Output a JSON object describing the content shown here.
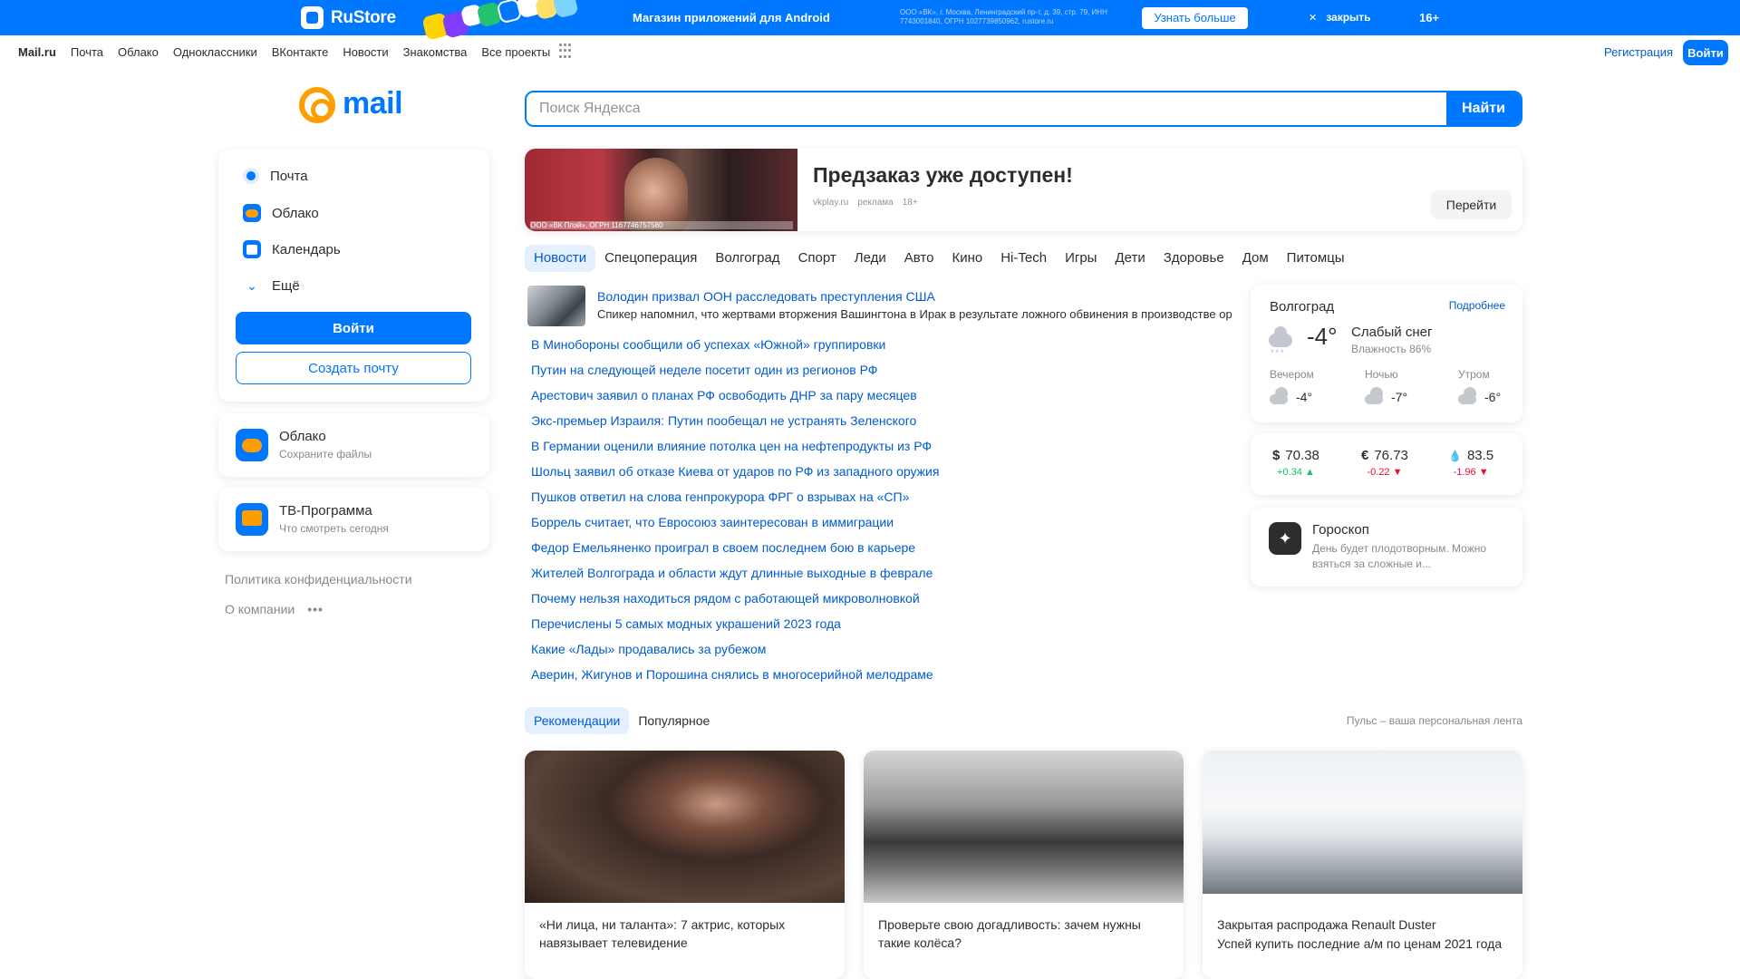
{
  "banner": {
    "brand": "RuStore",
    "tagline": "Магазин приложений для Android",
    "legal": "ООО «ВК», г. Москва, Ленинградский пр-т, д. 39, стр. 79, ИНН 7743001840, ОГРН 1027739850962, rustore.ru",
    "learn_more": "Узнать больше",
    "close": "закрыть",
    "age": "16+"
  },
  "portal_nav": {
    "items": [
      "Mail.ru",
      "Почта",
      "Облако",
      "Одноклассники",
      "ВКонтакте",
      "Новости",
      "Знакомства",
      "Все проекты"
    ],
    "register": "Регистрация",
    "login": "Войти"
  },
  "logo": {
    "text": "mail"
  },
  "search": {
    "placeholder": "Поиск Яндекса",
    "value": "",
    "button": "Найти"
  },
  "services": {
    "items": [
      {
        "label": "Почта",
        "icon": "mail-icon"
      },
      {
        "label": "Облако",
        "icon": "cloud-icon"
      },
      {
        "label": "Календарь",
        "icon": "calendar-icon"
      },
      {
        "label": "Ещё",
        "icon": "chevron-down-icon"
      }
    ],
    "login_button": "Войти",
    "create_button": "Создать почту"
  },
  "cloud_card": {
    "title": "Облако",
    "subtitle": "Сохраните файлы"
  },
  "tv_card": {
    "title": "ТВ-Программа",
    "subtitle": "Что смотреть сегодня"
  },
  "footer_links": {
    "privacy": "Политика конфиденциальности",
    "about": "О компании"
  },
  "promo": {
    "title": "Предзаказ уже доступен!",
    "domain": "vkplay.ru",
    "ad_label": "реклама",
    "age": "18+",
    "legal": "ООО «ВК Плэй», ОГРН 1167746757580",
    "button": "Перейти"
  },
  "news_tabs": [
    "Новости",
    "Спецоперация",
    "Волгоград",
    "Спорт",
    "Леди",
    "Авто",
    "Кино",
    "Hi-Tech",
    "Игры",
    "Дети",
    "Здоровье",
    "Дом",
    "Питомцы"
  ],
  "news_lead": {
    "title": "Володин призвал ООН расследовать преступления США",
    "subtitle": "Спикер напомнил, что жертвами вторжения Вашингтона в Ирак в результате ложного обвинения в производстве оружия массового поражения"
  },
  "news_items": [
    "В Минобороны сообщили об успехах «Южной» группировки",
    "Путин на следующей неделе посетит один из регионов РФ",
    "Арестович заявил о планах РФ освободить ДНР за пару месяцев",
    "Экс-премьер Израиля: Путин пообещал не устранять Зеленского",
    "В Германии оценили влияние потолка цен на нефтепродукты из РФ",
    "Шольц заявил об отказе Киева от ударов по РФ из западного оружия",
    "Пушков ответил на слова генпрокурора ФРГ о взрывах на «СП»",
    "Боррель считает, что Евросоюз заинтересован в иммиграции",
    "Федор Емельяненко проиграл в своем последнем бою в карьере",
    "Жителей Волгограда и области ждут длинные выходные в феврале",
    "Почему нельзя находиться рядом с работающей микроволновкой",
    "Перечислены 5 самых модных украшений 2023 года",
    "Какие «Лады» продавались за рубежом",
    "Аверин, Жигунов и Порошина снялись в многосерийной мелодраме"
  ],
  "weather": {
    "city": "Волгоград",
    "more": "Подробнее",
    "temp": "-4°",
    "description": "Слабый снег",
    "humidity": "Влажность 86%",
    "parts": [
      {
        "label": "Вечером",
        "temp": "-4°"
      },
      {
        "label": "Ночью",
        "temp": "-7°"
      },
      {
        "label": "Утром",
        "temp": "-6°"
      }
    ]
  },
  "rates": [
    {
      "symbol": "$",
      "value": "70.38",
      "delta": "+0.34 ▲",
      "trend": "up"
    },
    {
      "symbol": "€",
      "value": "76.73",
      "delta": "-0.22 ▼",
      "trend": "down"
    },
    {
      "symbol": "💧",
      "value": "83.5",
      "delta": "-1.96 ▼",
      "trend": "down"
    }
  ],
  "horoscope": {
    "title": "Гороскоп",
    "text": "День будет плодотворным. Можно взяться за сложные и..."
  },
  "pulse": {
    "tabs": [
      "Рекомендации",
      "Популярное"
    ],
    "note": "Пульс – ваша персональная лента"
  },
  "feed": [
    {
      "title": "«Ни лица, ни таланта»: 7 актрис, которых навязывает телевидение",
      "subtitle": ""
    },
    {
      "title": "Проверьте свою догадливость: зачем нужны такие колёса?",
      "subtitle": ""
    },
    {
      "title": "Закрытая распродажа Renault Duster",
      "subtitle": "Успей купить последние а/м по ценам 2021 года"
    }
  ],
  "colors": {
    "accent": "#0077ff",
    "link": "#005bd1",
    "logo_orange": "#ff9e00",
    "up": "#0dc268",
    "down": "#ed0a34"
  }
}
